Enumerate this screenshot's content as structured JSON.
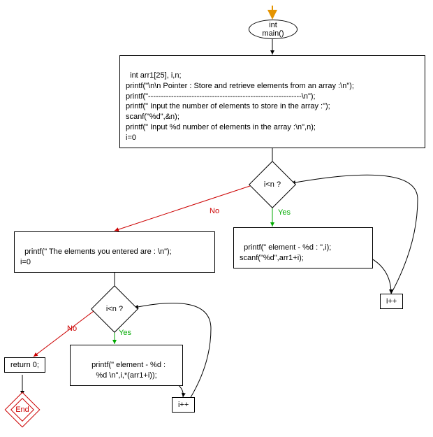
{
  "chart_data": {
    "type": "flowchart",
    "nodes": [
      {
        "id": "start_arrow",
        "type": "entry-arrow"
      },
      {
        "id": "main",
        "type": "oval",
        "text": "int main()"
      },
      {
        "id": "init",
        "type": "rect",
        "text": "int arr1[25], i,n;\nprintf(\"\\n\\n Pointer : Store and retrieve elements from an array :\\n\");\nprintf(\"------------------------------------------------------------\\n\");\nprintf(\" Input the number of elements to store in the array :\");\nscanf(\"%d\",&n);\nprintf(\" Input %d number of elements in the array :\\n\",n);\ni=0"
      },
      {
        "id": "cond1",
        "type": "diamond",
        "text": "i<n ?"
      },
      {
        "id": "loop1body",
        "type": "rect",
        "text": "printf(\" element - %d : \",i);\nscanf(\"%d\",arr1+i);"
      },
      {
        "id": "inc1",
        "type": "rect",
        "text": "i++"
      },
      {
        "id": "afterloop1",
        "type": "rect",
        "text": "printf(\" The elements you entered are : \\n\");\ni=0"
      },
      {
        "id": "cond2",
        "type": "diamond",
        "text": "i<n ?"
      },
      {
        "id": "loop2body",
        "type": "rect",
        "text": "printf(\" element - %d :\n%d \\n\",i,*(arr1+i));"
      },
      {
        "id": "inc2",
        "type": "rect",
        "text": "i++"
      },
      {
        "id": "ret",
        "type": "rect",
        "text": "return 0;"
      },
      {
        "id": "end",
        "type": "end",
        "text": "End"
      }
    ],
    "edges": [
      {
        "from": "start_arrow",
        "to": "main"
      },
      {
        "from": "main",
        "to": "init"
      },
      {
        "from": "init",
        "to": "cond1"
      },
      {
        "from": "cond1",
        "to": "loop1body",
        "label": "Yes"
      },
      {
        "from": "loop1body",
        "to": "inc1"
      },
      {
        "from": "inc1",
        "to": "cond1"
      },
      {
        "from": "cond1",
        "to": "afterloop1",
        "label": "No"
      },
      {
        "from": "afterloop1",
        "to": "cond2"
      },
      {
        "from": "cond2",
        "to": "loop2body",
        "label": "Yes"
      },
      {
        "from": "loop2body",
        "to": "inc2"
      },
      {
        "from": "inc2",
        "to": "cond2"
      },
      {
        "from": "cond2",
        "to": "ret",
        "label": "No"
      },
      {
        "from": "ret",
        "to": "end"
      }
    ]
  },
  "labels": {
    "yes": "Yes",
    "no": "No"
  },
  "nodes": {
    "main": "int main()",
    "init": "int arr1[25], i,n;\nprintf(\"\\n\\n Pointer : Store and retrieve elements from an array :\\n\");\nprintf(\"------------------------------------------------------------\\n\");\nprintf(\" Input the number of elements to store in the array :\");\nscanf(\"%d\",&n);\nprintf(\" Input %d number of elements in the array :\\n\",n);\ni=0",
    "cond1": "i<n ?",
    "loop1body": "printf(\" element - %d : \",i);\nscanf(\"%d\",arr1+i);",
    "inc1": "i++",
    "afterloop1": "printf(\" The elements you entered are : \\n\");\ni=0",
    "cond2": "i<n ?",
    "loop2body": "printf(\" element - %d :\n%d \\n\",i,*(arr1+i));",
    "inc2": "i++",
    "ret": "return 0;",
    "end": "End"
  }
}
